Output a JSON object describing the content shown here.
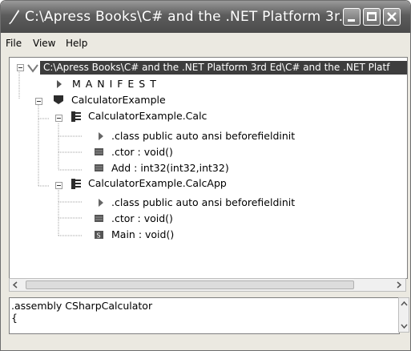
{
  "window": {
    "title": "C:\\Apress Books\\C# and the .NET Platform 3r...",
    "icon": "quill-icon",
    "buttons": [
      "minimize",
      "maximize",
      "close"
    ]
  },
  "menu": {
    "items": [
      "File",
      "View",
      "Help"
    ]
  },
  "tree": {
    "root_label": "C:\\Apress Books\\C# and the .NET Platform 3rd Ed\\C# and the .NET Platf",
    "manifest_label": "M A N I F E S T",
    "namespace_label": "CalculatorExample",
    "calc_class_label": "CalculatorExample.Calc",
    "calc_class_info": ".class public auto ansi beforefieldinit",
    "calc_ctor": ".ctor : void()",
    "calc_add": "Add : int32(int32,int32)",
    "calcapp_class_label": "CalculatorExample.CalcApp",
    "calcapp_class_info": ".class public auto ansi beforefieldinit",
    "calcapp_ctor": ".ctor : void()",
    "calcapp_main": "Main : void()"
  },
  "bottom_pane": {
    "line1": ".assembly CSharpCalculator",
    "line2": "{"
  }
}
